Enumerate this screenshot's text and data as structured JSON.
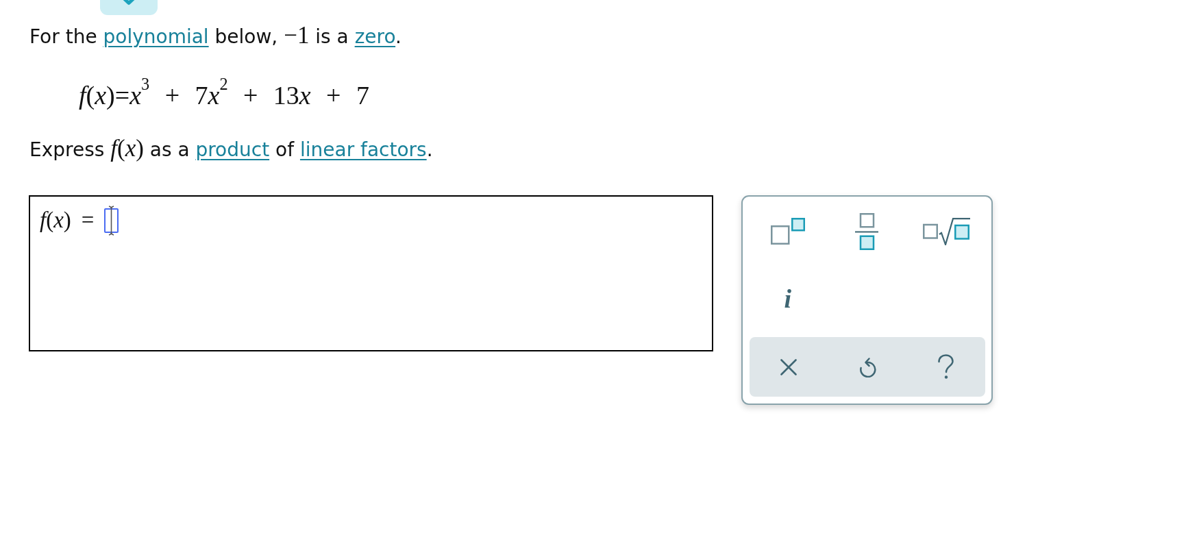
{
  "question": {
    "intro": [
      {
        "kind": "text",
        "text": "For the "
      },
      {
        "kind": "link",
        "text": "polynomial"
      },
      {
        "kind": "text",
        "text": " below, "
      },
      {
        "kind": "math",
        "text": "−1"
      },
      {
        "kind": "text",
        "text": " is a "
      },
      {
        "kind": "link",
        "text": "zero"
      },
      {
        "kind": "text",
        "text": "."
      }
    ],
    "formula": [
      "*f*(*x*)=*x*$^{3}$",
      " + 7",
      "*x*$^{2}$",
      " + 13",
      "*x*",
      " + 7"
    ],
    "instruction": [
      {
        "kind": "text",
        "text": "Express "
      },
      {
        "kind": "math",
        "text": "*f*(*x*)"
      },
      {
        "kind": "text",
        "text": " as a "
      },
      {
        "kind": "link",
        "text": "product"
      },
      {
        "kind": "text",
        "text": " of "
      },
      {
        "kind": "link",
        "text": "linear factors"
      },
      {
        "kind": "text",
        "text": "."
      }
    ]
  },
  "answer": {
    "label": "*f*(*x*) =",
    "slot": {
      "focused": true
    }
  },
  "keypad": {
    "keys": [
      {
        "kind": "superscript"
      },
      {
        "kind": "fraction"
      },
      {
        "kind": "root"
      },
      {
        "kind": "symbol",
        "label": "i"
      }
    ],
    "actions": [
      {
        "kind": "clear"
      },
      {
        "kind": "undo"
      },
      {
        "kind": "help"
      }
    ]
  }
}
